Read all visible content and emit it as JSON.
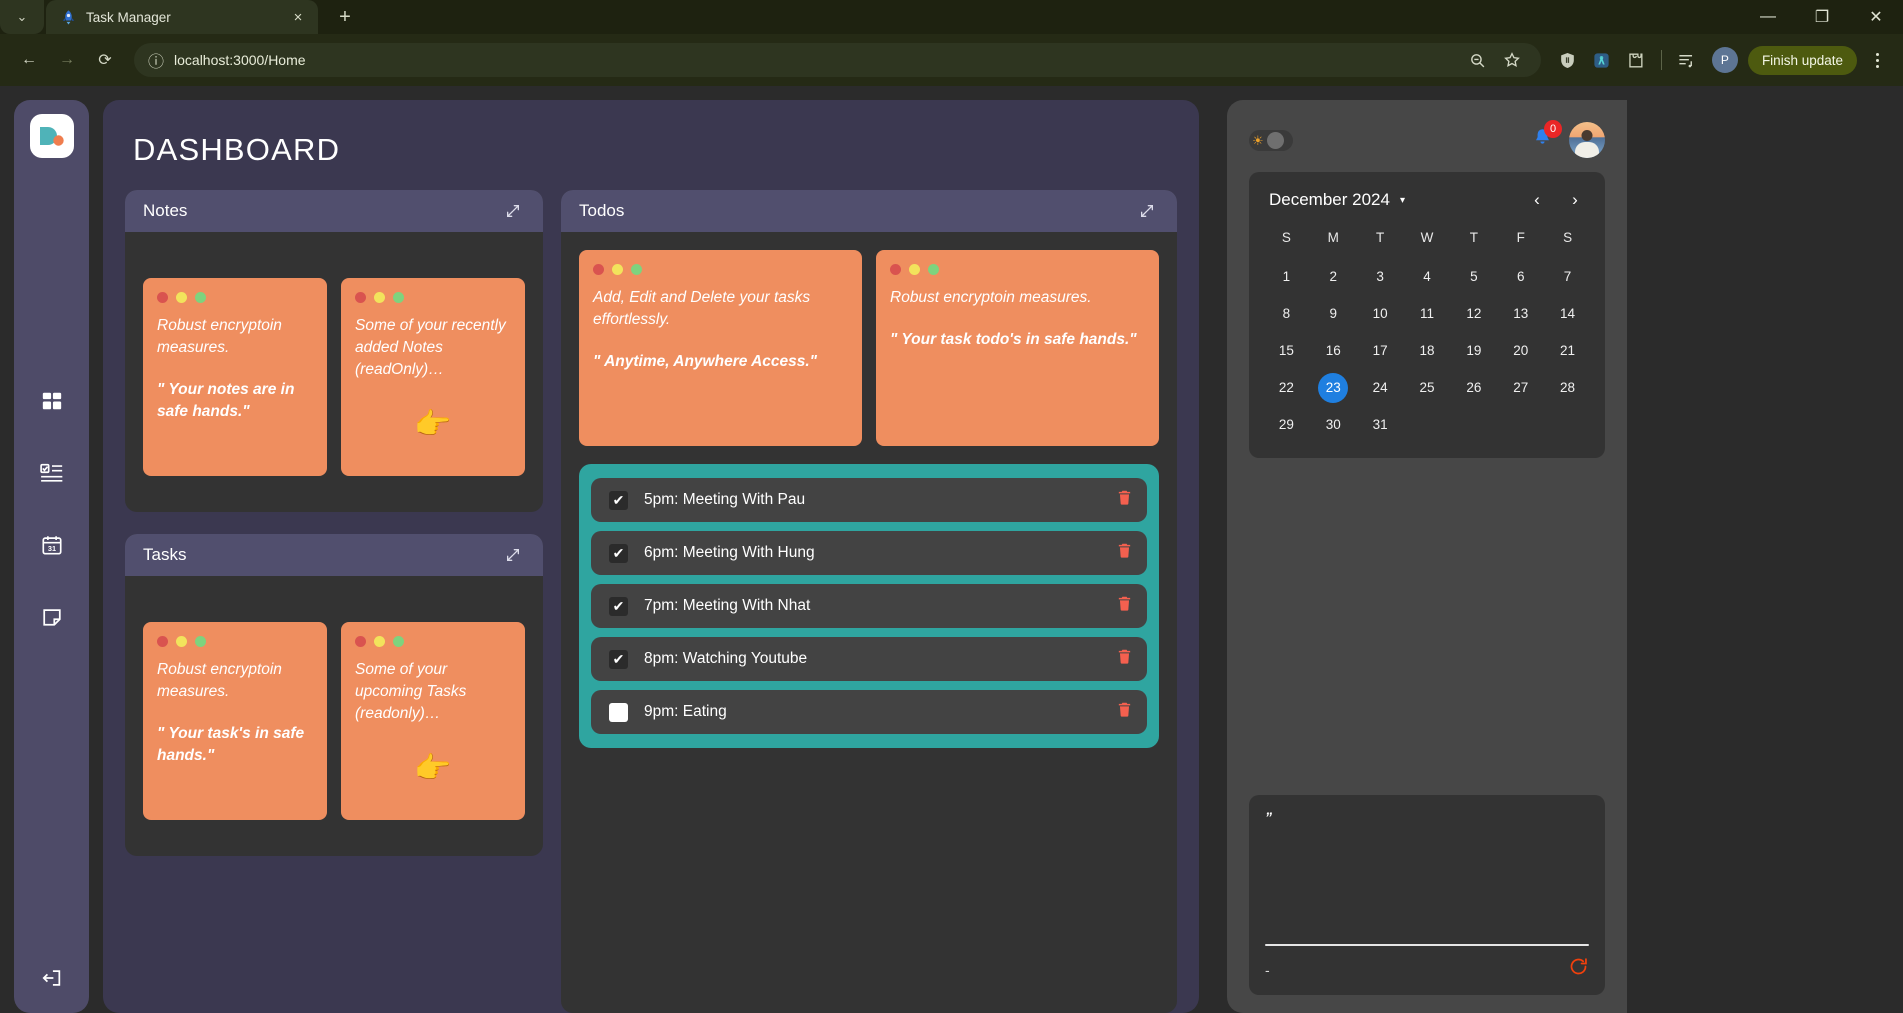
{
  "browser": {
    "tab": {
      "title": "Task Manager",
      "favicon": "rocket-icon",
      "close": "×"
    },
    "tab_list_caret": "⌄",
    "new_tab": "+",
    "window_controls": {
      "minimize": "—",
      "maximize": "❐",
      "close": "✕"
    },
    "toolbar": {
      "back": "←",
      "forward": "→",
      "reload": "⟳",
      "site_info": "ⓘ",
      "url": "localhost:3000/Home",
      "zoom_out_icon": "search-minus-icon",
      "bookmark_icon": "star-icon",
      "shield_icon": "shield-icon",
      "extension_a_icon": "compass-icon",
      "extension_b_icon": "puzzle-icon",
      "reading_list_icon": "reading-list-icon",
      "profile_initial": "P",
      "finish_update_label": "Finish update",
      "menu_icon": "kebab-menu-icon"
    }
  },
  "sidebar": {
    "logo": "app-logo",
    "items": [
      {
        "name": "dashboard",
        "icon": "grid-icon"
      },
      {
        "name": "todos",
        "icon": "checklist-icon"
      },
      {
        "name": "calendar",
        "icon": "calendar-31-icon"
      },
      {
        "name": "notes",
        "icon": "note-icon"
      }
    ],
    "logout": {
      "name": "logout",
      "icon": "logout-icon"
    }
  },
  "dashboard": {
    "title": "DASHBOARD",
    "panels": {
      "notes": {
        "title": "Notes",
        "expand_icon": "expand-diagonal-icon",
        "cards": [
          {
            "line1": "Robust encryptoin measures.",
            "quote": "\" Your notes are in safe hands.\"",
            "hand": ""
          },
          {
            "line1": "Some of your recently added Notes (readOnly)…",
            "quote": "",
            "hand": "👉"
          }
        ]
      },
      "tasks": {
        "title": "Tasks",
        "expand_icon": "expand-diagonal-icon",
        "cards": [
          {
            "line1": "Robust encryptoin measures.",
            "quote": "\" Your task's in safe hands.\"",
            "hand": ""
          },
          {
            "line1": "Some of your upcoming Tasks (readonly)…",
            "quote": "",
            "hand": "👉"
          }
        ]
      },
      "todos": {
        "title": "Todos",
        "expand_icon": "expand-diagonal-icon",
        "cards": [
          {
            "line1": "Add, Edit and Delete your tasks effortlessly.",
            "quote": "\" Anytime, Anywhere Access.\"",
            "hand": ""
          },
          {
            "line1": "Robust encryptoin measures.",
            "quote": "\" Your task todo's in safe hands.\"",
            "hand": ""
          }
        ],
        "items": [
          {
            "label": "5pm: Meeting With Pau",
            "done": true,
            "delete_icon": "trash-icon"
          },
          {
            "label": "6pm: Meeting With Hung",
            "done": true,
            "delete_icon": "trash-icon"
          },
          {
            "label": "7pm: Meeting With Nhat",
            "done": true,
            "delete_icon": "trash-icon"
          },
          {
            "label": "8pm: Watching Youtube",
            "done": true,
            "delete_icon": "trash-icon"
          },
          {
            "label": "9pm: Eating",
            "done": false,
            "delete_icon": "trash-icon"
          }
        ],
        "check_glyph": "✔"
      }
    }
  },
  "right_panel": {
    "theme_toggle": {
      "icon": "sun-icon",
      "glyph": "☀",
      "state": "light"
    },
    "notifications": {
      "icon": "bell-icon",
      "count": "0"
    },
    "avatar": "user-avatar",
    "calendar": {
      "month_label": "December 2024",
      "caret": "▾",
      "prev": "‹",
      "next": "›",
      "dow": [
        "S",
        "M",
        "T",
        "W",
        "T",
        "F",
        "S"
      ],
      "lead_blanks": 0,
      "days": [
        1,
        2,
        3,
        4,
        5,
        6,
        7,
        8,
        9,
        10,
        11,
        12,
        13,
        14,
        15,
        16,
        17,
        18,
        19,
        20,
        21,
        22,
        23,
        24,
        25,
        26,
        27,
        28,
        29,
        30,
        31
      ],
      "today": 23
    },
    "composer": {
      "quote": "”",
      "value": "",
      "dash": "-",
      "refresh_icon": "refresh-icon",
      "refresh_glyph": "↺"
    }
  },
  "colors": {
    "accent_purple": "#4e4b68",
    "panel_header": "#514f6e",
    "card_orange": "#ef8e5f",
    "todo_teal": "#2fa5a0",
    "today_blue": "#1f7fe0",
    "badge_red": "#ea2626",
    "trash_red": "#f4604f",
    "refresh_orange": "#f1400c"
  }
}
